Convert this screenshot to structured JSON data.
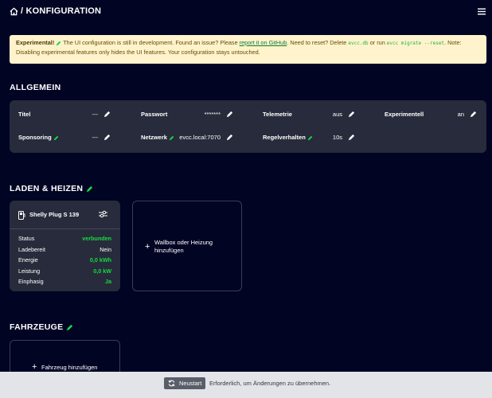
{
  "header": {
    "separator": "/",
    "title": "KONFIGURATION",
    "icons": [
      "home-icon",
      "hamburger-menu-icon"
    ]
  },
  "alert": {
    "strong": "Experimental!",
    "text1": " The UI configuration is still in development. Found an issue? Please ",
    "link": "report it on GitHub",
    "text2": ". Need to reset? Delete ",
    "code1": "evcc.db",
    "text3": " or run ",
    "code2": "evcc migrate --reset",
    "text4": ". Note: Disabling experimental features only hides the UI features. Your configuration stays untouched.",
    "background": "#fff3cd"
  },
  "general": {
    "heading": "ALLGEMEIN",
    "settings": [
      {
        "label": "Titel",
        "value": "---"
      },
      {
        "label": "Passwort",
        "value": "*******"
      },
      {
        "label": "Telemetrie",
        "value": "aus"
      },
      {
        "label": "Experimentell",
        "value": "an"
      },
      {
        "label": "Sponsoring",
        "value": "---"
      },
      {
        "label": "Netzwerk",
        "value": "evcc.local:7070"
      },
      {
        "label": "Regelverhalten",
        "value": "10s"
      }
    ]
  },
  "loadpoints": {
    "heading": "LADEN & HEIZEN",
    "card": {
      "title": "Shelly Plug S 139",
      "rows": [
        {
          "key": "Status",
          "value": "verbunden"
        },
        {
          "key": "Ladebereit",
          "value": "Nein"
        },
        {
          "key": "Energie",
          "value": "0,0 kWh"
        },
        {
          "key": "Leistung",
          "value": "0,0 kW"
        },
        {
          "key": "Einphasig",
          "value": "Ja"
        }
      ]
    },
    "add_line1": "Wallbox oder Heizung",
    "add_line2": "hinzufügen"
  },
  "vehicles": {
    "heading": "FAHRZEUGE",
    "add": "Fahrzeug hinzufügen"
  },
  "footer": {
    "button": "Neustart",
    "message": "Erforderlich, um Änderungen zu übernehmen."
  },
  "colors": {
    "background": "#020424",
    "panel": "#282b3b",
    "accent_green": "#0fdd42",
    "footer": "#e3e4e8"
  }
}
